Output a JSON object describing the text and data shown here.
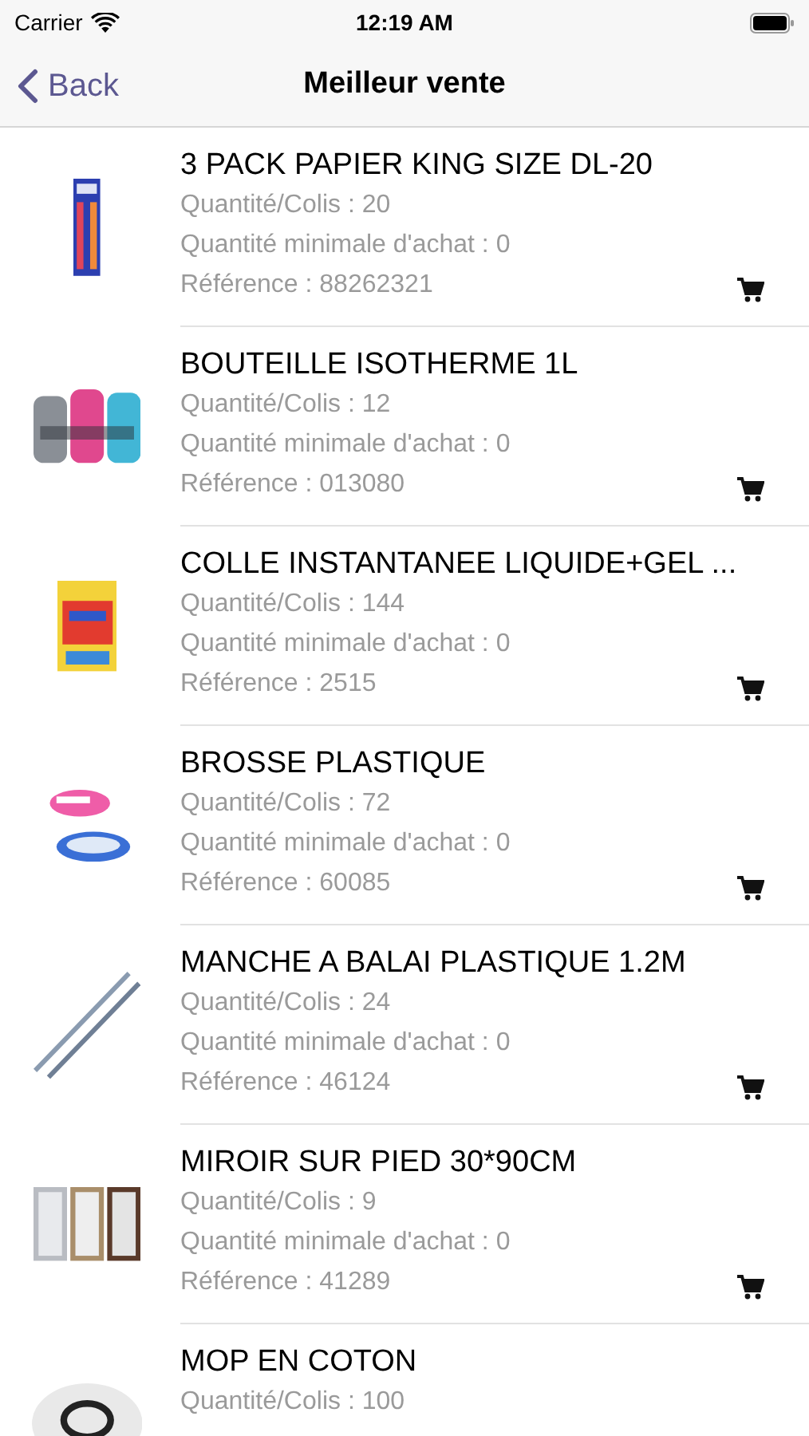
{
  "status_bar": {
    "carrier": "Carrier",
    "time": "12:19 AM"
  },
  "nav": {
    "back": "Back",
    "title": "Meilleur vente"
  },
  "products": [
    {
      "name": "3 PACK PAPIER KING SIZE DL-20",
      "quantity": "Quantité/Colis : 20",
      "minimum": "Quantité minimale d'achat : 0",
      "reference": "Référence : 88262321"
    },
    {
      "name": "BOUTEILLE ISOTHERME 1L",
      "quantity": "Quantité/Colis : 12",
      "minimum": "Quantité minimale d'achat : 0",
      "reference": "Référence : 013080"
    },
    {
      "name": "COLLE INSTANTANEE LIQUIDE+GEL ...",
      "quantity": "Quantité/Colis : 144",
      "minimum": "Quantité minimale d'achat : 0",
      "reference": "Référence : 2515"
    },
    {
      "name": "BROSSE PLASTIQUE",
      "quantity": "Quantité/Colis : 72",
      "minimum": "Quantité minimale d'achat : 0",
      "reference": "Référence : 60085"
    },
    {
      "name": "MANCHE A BALAI PLASTIQUE 1.2M",
      "quantity": "Quantité/Colis : 24",
      "minimum": "Quantité minimale d'achat : 0",
      "reference": "Référence : 46124"
    },
    {
      "name": "MIROIR SUR PIED 30*90CM",
      "quantity": "Quantité/Colis : 9",
      "minimum": "Quantité minimale d'achat : 0",
      "reference": "Référence : 41289"
    },
    {
      "name": "MOP EN COTON",
      "quantity": "Quantité/Colis : 100"
    }
  ]
}
